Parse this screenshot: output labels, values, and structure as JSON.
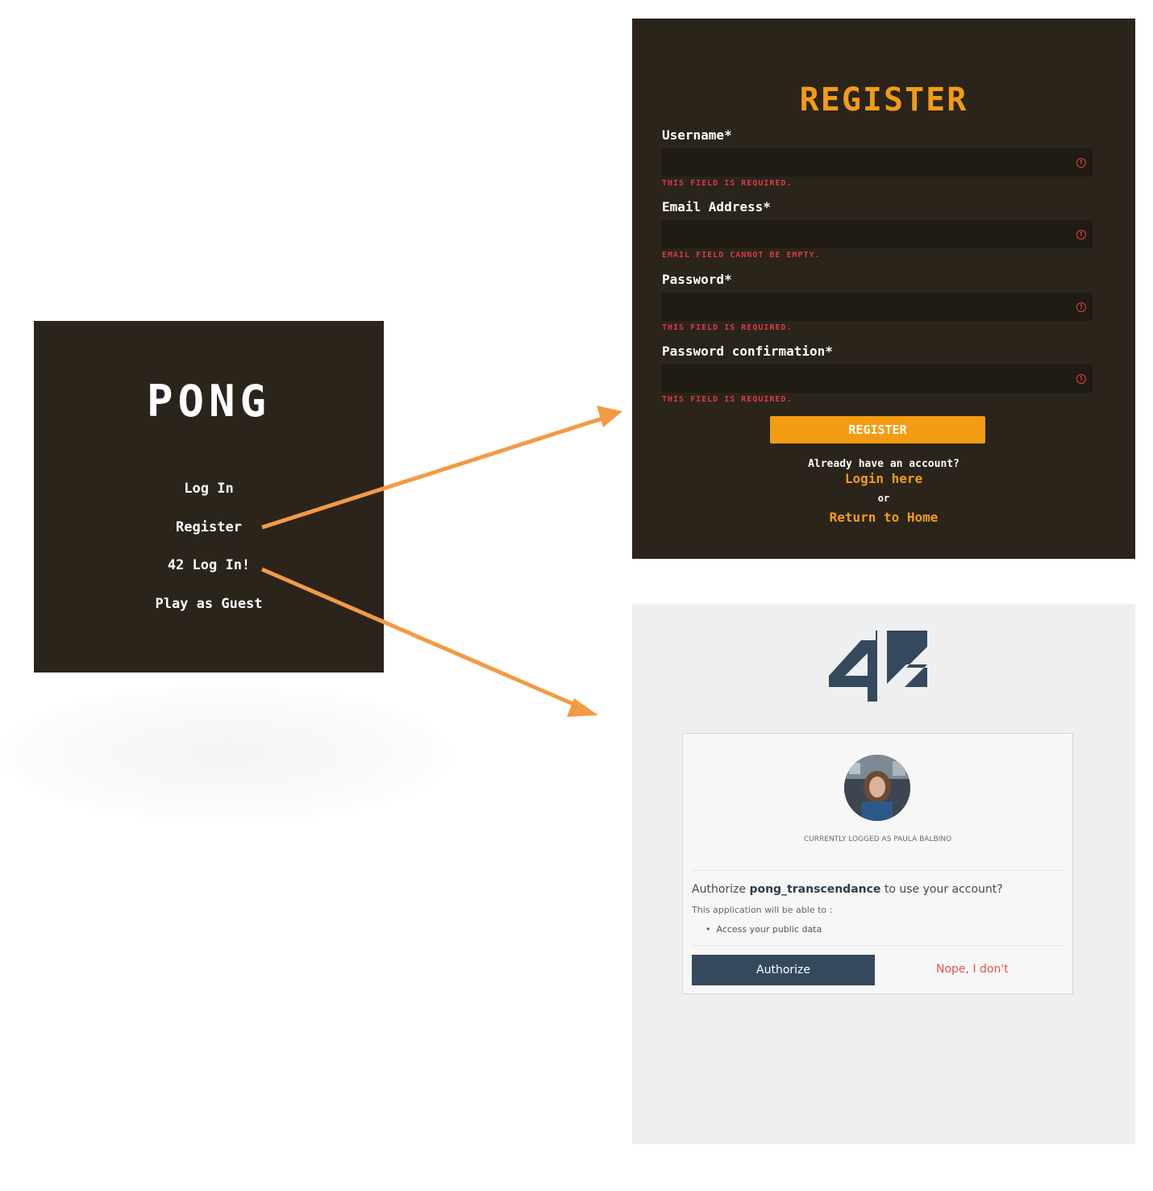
{
  "pong": {
    "title": "PONG",
    "menu": [
      "Log In",
      "Register",
      "42 Log In!",
      "Play as Guest"
    ]
  },
  "register": {
    "title": "REGISTER",
    "fields": [
      {
        "label": "Username*",
        "error": "THIS FIELD IS REQUIRED."
      },
      {
        "label": "Email Address*",
        "error": "EMAIL FIELD CANNOT BE EMPTY."
      },
      {
        "label": "Password*",
        "error": "THIS FIELD IS REQUIRED."
      },
      {
        "label": "Password confirmation*",
        "error": "THIS FIELD IS REQUIRED."
      }
    ],
    "button": "REGISTER",
    "already": "Already have an account?",
    "login_link": "Login here",
    "or": "or",
    "home_link": "Return to Home",
    "accent_color": "#f39c12",
    "error_color": "#d8394a"
  },
  "auth": {
    "logo_text": "42",
    "logged_as": "CURRENTLY LOGGED AS PAULA BALBINO",
    "question_prefix": "Authorize ",
    "app_name": "pong_transcendance",
    "question_suffix": " to use your account?",
    "able_to": "This application will be able to :",
    "permission": "Access your public data",
    "authorize_btn": "Authorize",
    "nope_link": "Nope, I don't",
    "primary_color": "#34495e"
  },
  "arrow_color": "#f39a45"
}
